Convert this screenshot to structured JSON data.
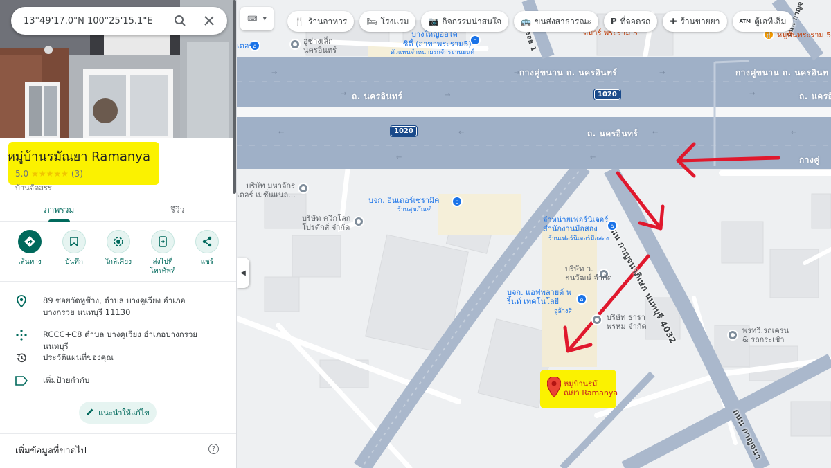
{
  "search": {
    "value": "13°49'17.0\"N 100°25'15.1\"E"
  },
  "place": {
    "title": "หมู่บ้านรมัณยา Ramanya",
    "rating": "5.0",
    "review_count": "(3)",
    "category": "บ้านจัดสรร"
  },
  "tabs": [
    {
      "label": "ภาพรวม"
    },
    {
      "label": "รีวิว"
    }
  ],
  "actions": [
    {
      "label": "เส้นทาง",
      "icon": "directions-icon"
    },
    {
      "label": "บันทึก",
      "icon": "bookmark-icon"
    },
    {
      "label": "ใกล้เคียง",
      "icon": "nearby-icon"
    },
    {
      "label": "ส่งไปที่โทรศัพท์",
      "icon": "send-to-phone-icon"
    },
    {
      "label": "แชร์",
      "icon": "share-icon"
    }
  ],
  "info": {
    "address": "89 ซอยวัดหูช้าง, ตำบล บางคูเวียง อำเภอบางกรวย นนทบุรี 11130",
    "plus_code": "RCCC+C8 ตำบล บางคูเวียง อำเภอบางกรวย นนทบุรี",
    "history": "ประวัติแผนที่ของคุณ",
    "add_label": "เพิ่มป้ายกำกับ"
  },
  "suggest_edit": "แนะนำให้แก้ไข",
  "missing_info": "เพิ่มข้อมูลที่ขาดไป",
  "chips": [
    {
      "label": "ร้านอาหาร",
      "icon": "restaurant-icon",
      "glyph": "🍴"
    },
    {
      "label": "โรงแรม",
      "icon": "hotel-icon",
      "glyph": "🛏"
    },
    {
      "label": "กิจกรรมน่าสนใจ",
      "icon": "camera-icon",
      "glyph": "📷"
    },
    {
      "label": "ขนส่งสาธารณะ",
      "icon": "transit-icon",
      "glyph": "🚌"
    },
    {
      "label": "ที่จอดรถ",
      "icon": "parking-icon",
      "glyph": "P"
    },
    {
      "label": "ร้านขายยา",
      "icon": "pharmacy-icon",
      "glyph": "✚"
    },
    {
      "label": "ตู้เอทีเอ็ม",
      "icon": "atm-icon",
      "glyph": "ATM"
    }
  ],
  "map": {
    "roads": {
      "parallel_top_left": "กางคู่ขนาน ถ. นครอินทร์",
      "parallel_top_right": "กางคู่ขนาน ถ. นครอินท",
      "main_upper": "ถ. นครอินทร์",
      "main_lower": "ถ. นครอินทร์",
      "parallel_right_lower": "กางคู่",
      "right_upper_cut": "ถ. นครอิ",
      "kanchana": "ถนน กาญจนาภิเษก นนทบุรี 4032",
      "kanchana_bottom": "ถนน กาญจนา",
      "top_road_cut": "ซอย 1",
      "top_right_cut": "ถนน กาญจ"
    },
    "shields": [
      "1020",
      "1020"
    ],
    "pois": [
      {
        "name": "อู่ช่างเล็ก\nนครอินทร์",
        "style": "gray"
      },
      {
        "name": "ซิตี้ (สาขาพระราม5)",
        "style": "blue"
      },
      {
        "name": "บางใหญ่ออโต้",
        "style": "blue"
      },
      {
        "name": "ตัวแทนจำหน่ายรถจักรยานยนต์",
        "style": "blue"
      },
      {
        "name": "ดีมาร์ พระราม 5",
        "style": "orange"
      },
      {
        "name": "หมูหันพระราม 5",
        "style": "orange"
      },
      {
        "name": "เตอร์",
        "style": "blue"
      },
      {
        "name": "บริษัท มหาจักร\nเตอร์ เมชั่นแนล...",
        "style": "gray"
      },
      {
        "name": "บจก. อินเตอร์เซรามิค",
        "style": "blue"
      },
      {
        "name": "ร้านสุขภัณฑ์",
        "style": "blue"
      },
      {
        "name": "บริษัท ควิกโลก\nโปรดักส์ จำกัด",
        "style": "gray"
      },
      {
        "name": "จำหน่ายเฟอร์นิเจอร์\nสำนักงานมือสอง",
        "style": "blue"
      },
      {
        "name": "ร้านเฟอร์นิเจอร์มือสอง",
        "style": "blue"
      },
      {
        "name": "บริษัท ว.\nธนวัฒน์ จำกัด",
        "style": "gray"
      },
      {
        "name": "บจก. แอฟพลายด์ พ\nริ้นท์ เทคโนโลยี",
        "style": "blue"
      },
      {
        "name": "อู่ล้างสี",
        "style": "blue"
      },
      {
        "name": "บริษัท ธารา\nพรหม จำกัด",
        "style": "gray"
      },
      {
        "name": "พรทวี.รถเครน\n& รถกระเช้า",
        "style": "gray"
      },
      {
        "name": "หมู่บ้านรมั\nณยา Ramanya",
        "style": "red"
      }
    ],
    "colors": {
      "highway": "#aab8cc",
      "background": "#eef0f2",
      "annotation": "#e0182d",
      "highlight": "#fbf200",
      "accent": "#00695c"
    }
  }
}
